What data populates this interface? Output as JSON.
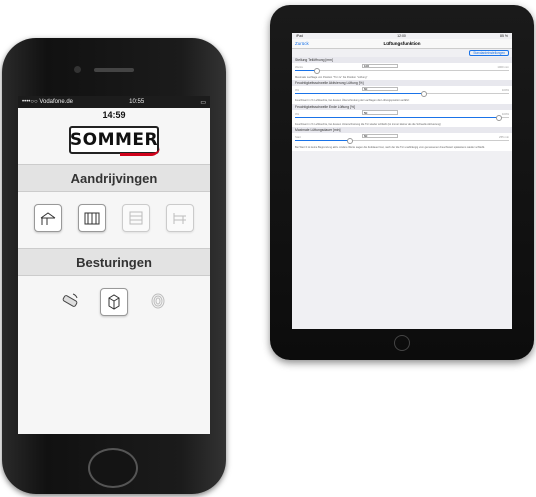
{
  "phone": {
    "status": {
      "carrier": "••••○○ Vodafone.de",
      "time": "10:55"
    },
    "clock": "14:59",
    "logo": "SOMMER",
    "sections": [
      {
        "title": "Aandrijvingen",
        "icons": [
          "sliding-gate-icon",
          "double-gate-icon",
          "garage-door-icon",
          "barrier-gate-icon"
        ]
      },
      {
        "title": "Besturingen",
        "icons": [
          "remote-control-icon",
          "control-unit-icon",
          "fingerprint-icon"
        ]
      }
    ]
  },
  "ipad": {
    "status": {
      "left": "iPad",
      "time": "12:00",
      "right": "85 %"
    },
    "nav": {
      "back": "Zurück",
      "title": "Lüftungsfunktion"
    },
    "segment": "Standardeinstellungen",
    "items": [
      {
        "label": "Stellung Teilöffnung [mm]",
        "min": "Werks",
        "value": "100",
        "max": "1000 mm",
        "level": 0.1,
        "note": "Maximale Lachlage von Position \"Tür zu\" bis Position \"Lüftung\""
      },
      {
        "label": "Feuchtigkeitsschwelle Aktivierung Lüftung [%]",
        "min": "0%",
        "value": "60",
        "max": "100%",
        "level": 0.6,
        "note": "Feuchtwert in % Luftfeuchte, bei dessen Überschreitung der Lachlagen die Lüftungsposition anfährt"
      },
      {
        "label": "Feuchtigkeitsschwelle Ende Lüftung [%]",
        "min": "0%",
        "value": "50",
        "max": "100%",
        "level": 0.95,
        "note": "Feuchtwert in % Luftfeuchte, bei dessen Unterschreitung die Tür wieder schließt (ist immer kleiner als die Schwelle Aktivierung)"
      },
      {
        "label": "Maximale Lüftungsdauer [min]",
        "min": "Start",
        "value": "60",
        "max": "255 min",
        "level": 0.25,
        "note": "Bei Wert 0 ist keine Begrenzung aktiv. Andere Werte sagen die Zeitdauer fest, nach der die Tür unabhängig vom gemessenen Feuchtwert spätestens wieder schließt."
      }
    ]
  }
}
